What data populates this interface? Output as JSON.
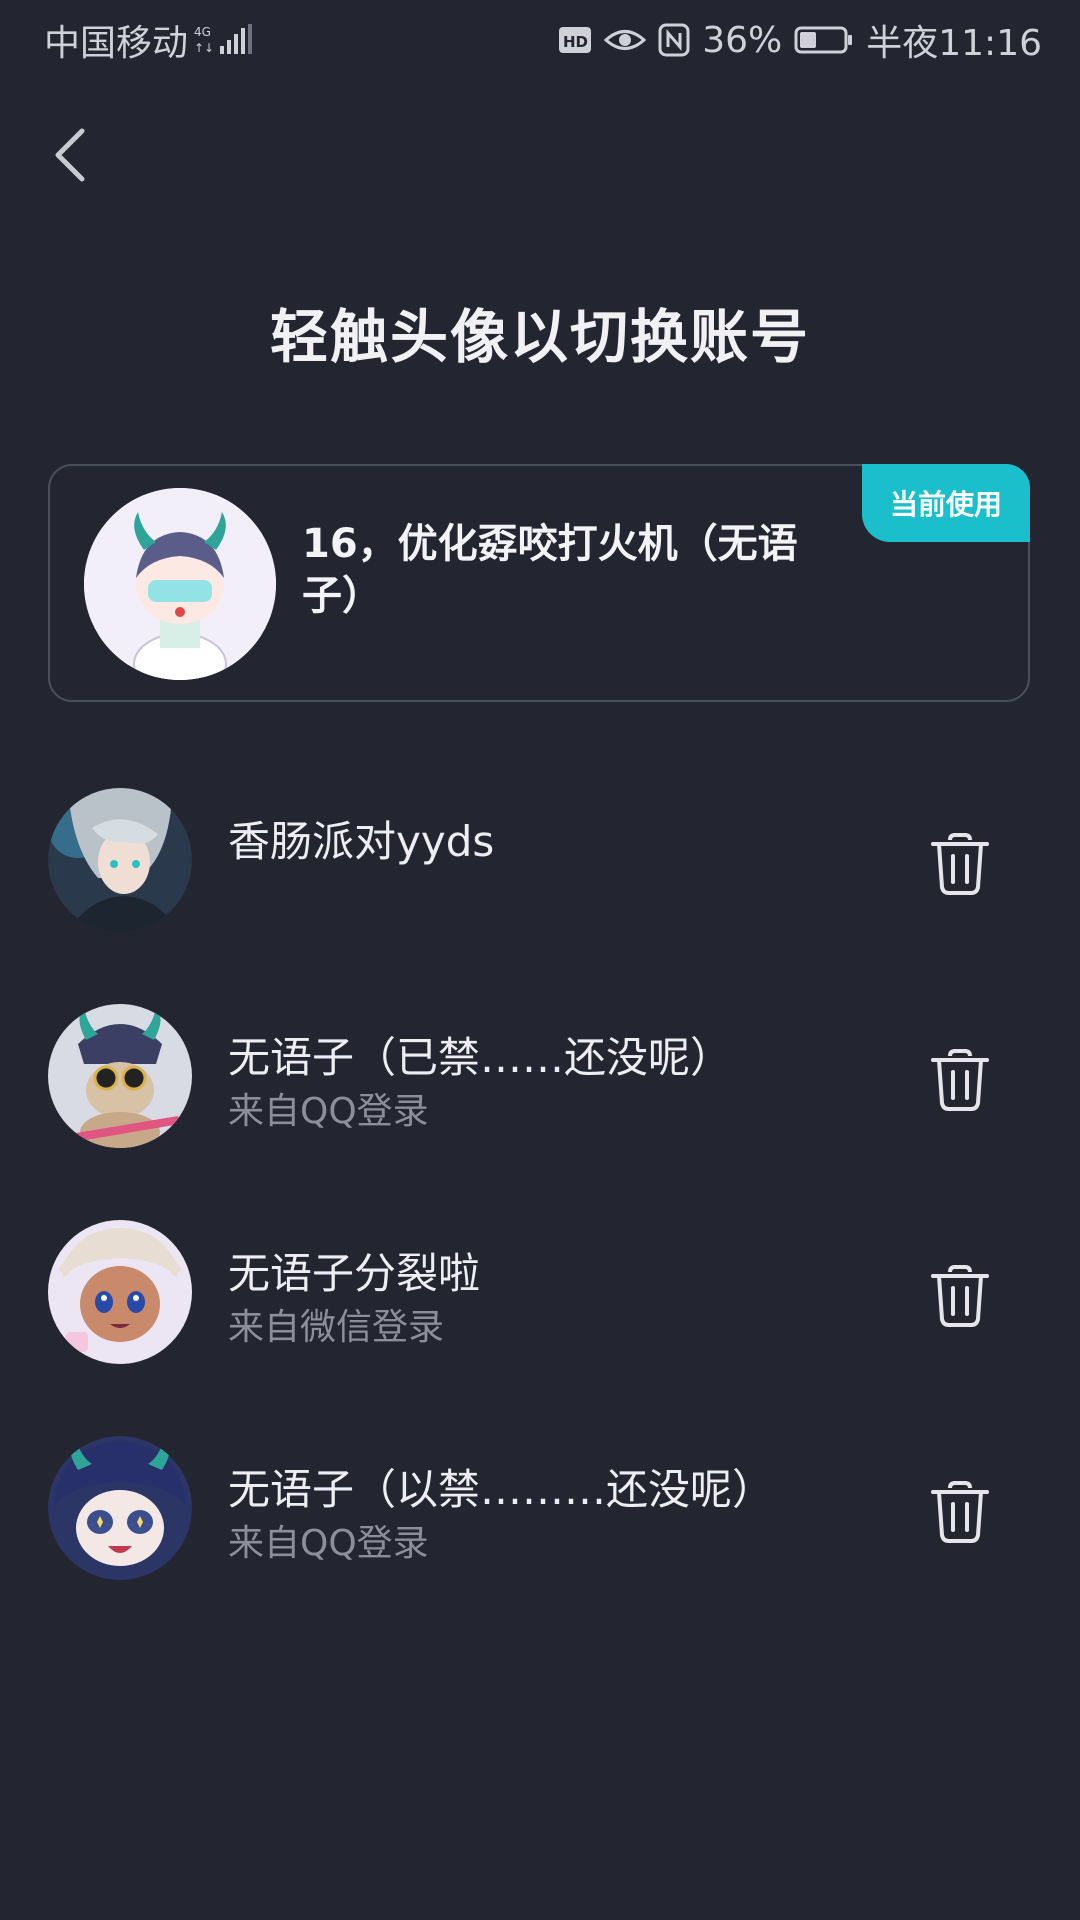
{
  "status_bar": {
    "carrier": "中国移动",
    "network": "4G",
    "battery": "36%",
    "time": "半夜11:16",
    "icons": [
      "signal-icon",
      "hd-icon",
      "eye-icon",
      "nfc-icon",
      "battery-icon"
    ]
  },
  "header": {
    "back_icon": "chevron-left-icon",
    "title": "轻触头像以切换账号"
  },
  "current_account": {
    "badge": "当前使用",
    "name": "16，优化孬咬打火机（无语子）"
  },
  "accounts": [
    {
      "name": "香肠派对yyds",
      "source": ""
    },
    {
      "name": "无语子（已禁……还没呢）",
      "source": "来自QQ登录"
    },
    {
      "name": "无语子分裂啦",
      "source": "来自微信登录"
    },
    {
      "name": "无语子（以禁………还没呢）",
      "source": "来自QQ登录"
    }
  ],
  "colors": {
    "background": "#232531",
    "accent": "#1bbfcc",
    "card_border": "#4a4d5b",
    "secondary_text": "#8c8e9a"
  }
}
